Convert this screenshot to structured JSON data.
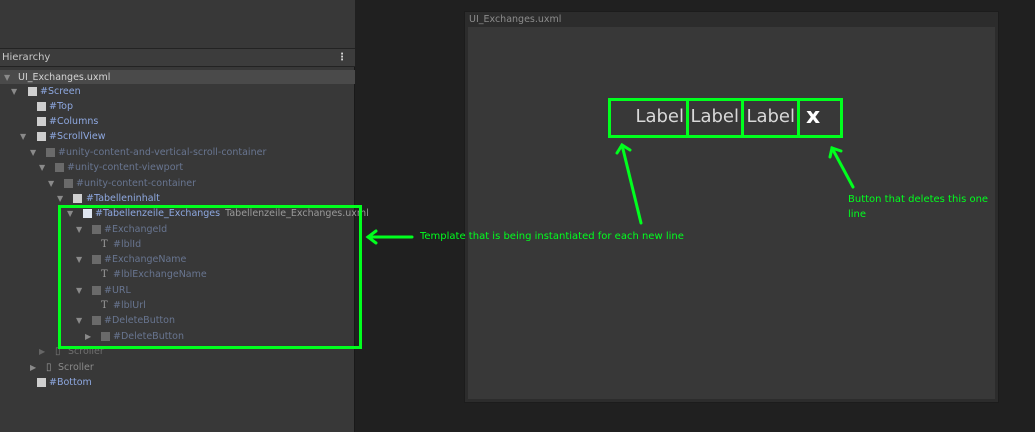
{
  "hierarchy": {
    "title": "Hierarchy",
    "menu_icon": "⋮",
    "items": [
      {
        "label": "UI_Exchanges.uxml"
      },
      {
        "label": "#Screen"
      },
      {
        "label": "#Top"
      },
      {
        "label": "#Columns"
      },
      {
        "label": "#ScrollView"
      },
      {
        "label": "#unity-content-and-vertical-scroll-container"
      },
      {
        "label": "#unity-content-viewport"
      },
      {
        "label": "#unity-content-container"
      },
      {
        "label": "#Tabelleninhalt"
      },
      {
        "label": "#Tabellenzeile_Exchanges",
        "suffix": "Tabellenzeile_Exchanges.uxml"
      },
      {
        "label": "#ExchangeId"
      },
      {
        "label": "#lblId"
      },
      {
        "label": "#ExchangeName"
      },
      {
        "label": "#lblExchangeName"
      },
      {
        "label": "#URL"
      },
      {
        "label": "#lblUrl"
      },
      {
        "label": "#DeleteButton"
      },
      {
        "label": "#DeleteButton"
      },
      {
        "label": "Scroller"
      },
      {
        "label": "Scroller"
      },
      {
        "label": "#Bottom"
      }
    ]
  },
  "canvas": {
    "title": "UI_Exchanges.uxml",
    "labels": [
      "Label",
      "Label",
      "Label"
    ],
    "delete_button": "x"
  },
  "annotations": {
    "template": "Template that is being instantiated for each new line",
    "button_line1": "Button that deletes this one",
    "button_line2": "line"
  },
  "colors": {
    "highlight": "#00ff1e"
  }
}
